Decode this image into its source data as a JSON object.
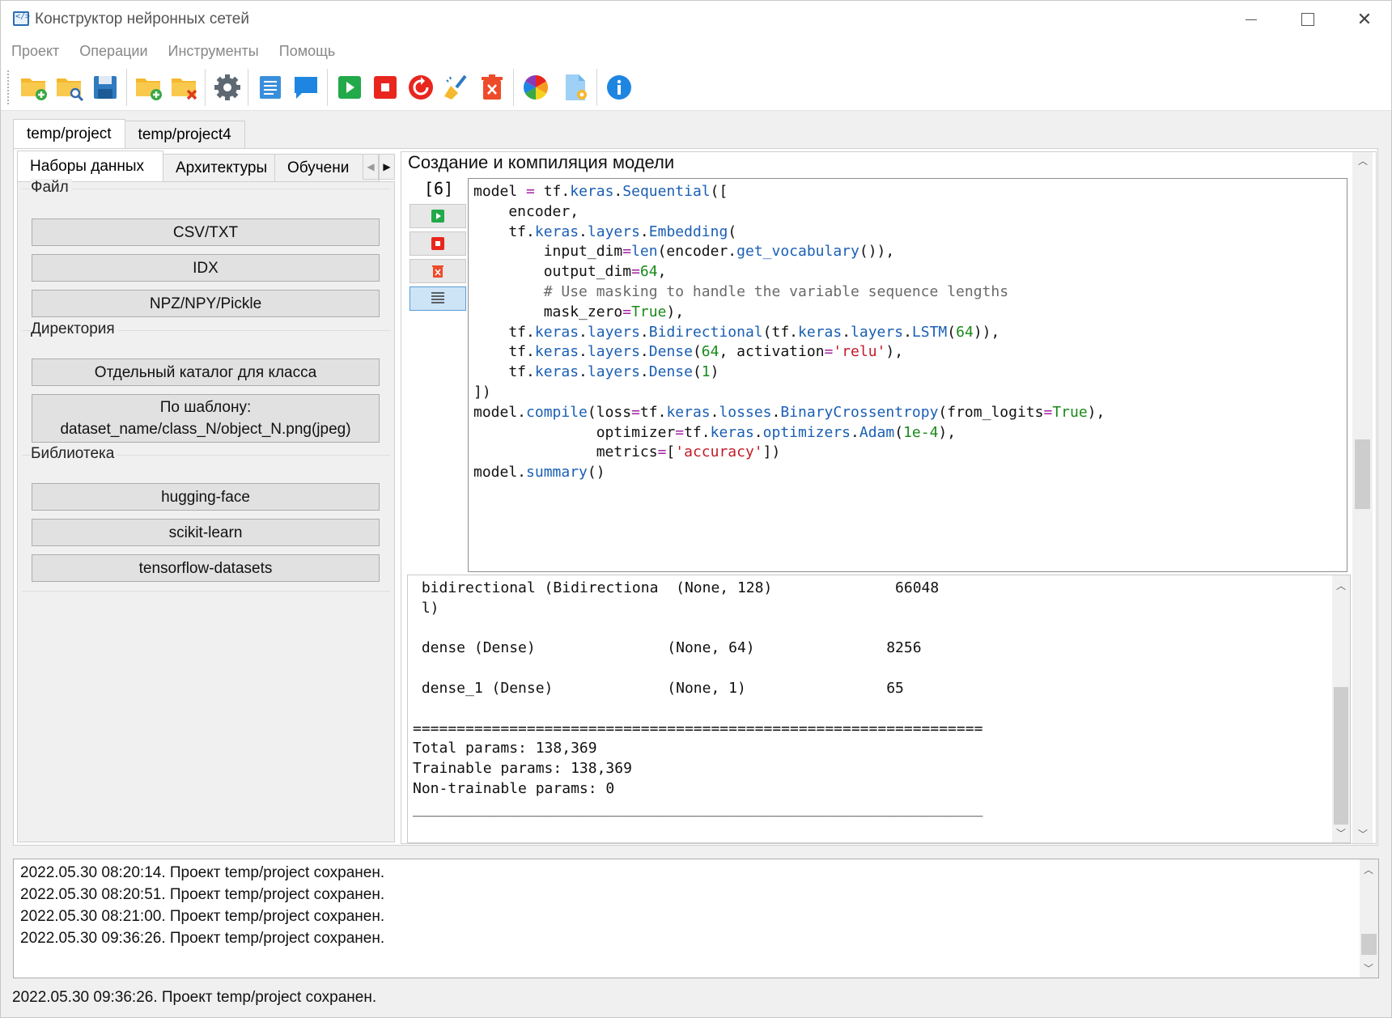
{
  "window": {
    "title": "Конструктор нейронных сетей",
    "minimize_icon": "minimize-icon",
    "maximize_icon": "maximize-icon",
    "close_glyph": "✕"
  },
  "menu": [
    "Проект",
    "Операции",
    "Инструменты",
    "Помощь"
  ],
  "toolbar": {
    "icons": [
      "new-project-icon",
      "open-project-icon",
      "save-icon",
      "add-folder-icon",
      "delete-folder-icon",
      "settings-icon",
      "document-icon",
      "comment-icon",
      "run-icon",
      "stop-icon",
      "restart-icon",
      "clear-icon",
      "delete-icon",
      "color-wheel-icon",
      "file-settings-icon",
      "info-icon"
    ]
  },
  "project_tabs": [
    "temp/project",
    "temp/project4"
  ],
  "sub_tabs": [
    "Наборы данных",
    "Архитектуры",
    "Обучени"
  ],
  "datasets": {
    "file_group": "Файл",
    "file_buttons": [
      "CSV/TXT",
      "IDX",
      "NPZ/NPY/Pickle"
    ],
    "dir_group": "Директория",
    "dir_button_1": "Отдельный каталог для класса",
    "dir_button_2_line1": "По шаблону:",
    "dir_button_2_line2": "dataset_name/class_N/object_N.png(jpeg)",
    "lib_group": "Библиотека",
    "lib_buttons": [
      "hugging-face",
      "scikit-learn",
      "tensorflow-datasets"
    ]
  },
  "cell": {
    "title": "Создание и компиляция модели",
    "number": "[6]"
  },
  "colors": {
    "keyword_blue": "#1a5fb4",
    "number_green": "#1a8a1a",
    "string_red": "#c01c28",
    "comment_gray": "#6a6a6a",
    "operator_purple": "#a020a0"
  },
  "code": [
    "model = tf.keras.Sequential([",
    "    encoder,",
    "    tf.keras.layers.Embedding(",
    "        input_dim=len(encoder.get_vocabulary()),",
    "        output_dim=64,",
    "        # Use masking to handle the variable sequence lengths",
    "        mask_zero=True),",
    "    tf.keras.layers.Bidirectional(tf.keras.layers.LSTM(64)),",
    "    tf.keras.layers.Dense(64, activation='relu'),",
    "    tf.keras.layers.Dense(1)",
    "])",
    "model.compile(loss=tf.keras.losses.BinaryCrossentropy(from_logits=True),",
    "              optimizer=tf.keras.optimizers.Adam(1e-4),",
    "              metrics=['accuracy'])",
    "model.summary()"
  ],
  "output": [
    " bidirectional (Bidirectiona  (None, 128)              66048",
    " l)",
    "",
    " dense (Dense)               (None, 64)               8256",
    "",
    " dense_1 (Dense)             (None, 1)                65",
    "",
    "=================================================================",
    "Total params: 138,369",
    "Trainable params: 138,369",
    "Non-trainable params: 0",
    "_________________________________________________________________"
  ],
  "log": [
    "2022.05.30 08:20:14. Проект temp/project сохранен.",
    "2022.05.30 08:20:51. Проект temp/project сохранен.",
    "2022.05.30 08:21:00. Проект temp/project сохранен.",
    "2022.05.30 09:36:26. Проект temp/project сохранен."
  ],
  "status": "2022.05.30 09:36:26. Проект temp/project сохранен."
}
